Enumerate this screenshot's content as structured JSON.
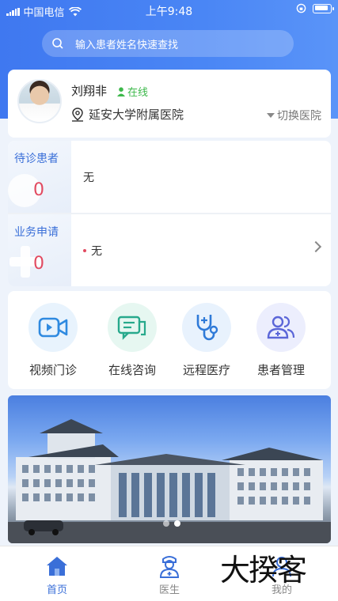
{
  "status_bar": {
    "carrier": "中国电信",
    "time": "上午9:48"
  },
  "search": {
    "placeholder": "输入患者姓名快速查找"
  },
  "doctor": {
    "name": "刘翔非",
    "status": "在线",
    "hospital": "延安大学附属医院",
    "switch_label": "切换医院"
  },
  "tasks": [
    {
      "title": "待诊患者",
      "count": "0",
      "value": "无"
    },
    {
      "title": "业务申请",
      "count": "0",
      "value": "无"
    }
  ],
  "quick_actions": [
    {
      "label": "视频门诊",
      "icon": "video-clinic-icon"
    },
    {
      "label": "在线咨询",
      "icon": "online-consult-icon"
    },
    {
      "label": "远程医疗",
      "icon": "stethoscope-icon"
    },
    {
      "label": "患者管理",
      "icon": "patients-icon"
    }
  ],
  "banner": {
    "slides": 2,
    "active_slide": 1
  },
  "tabbar": {
    "items": [
      {
        "label": "首页",
        "icon": "home-icon",
        "active": true
      },
      {
        "label": "医生",
        "icon": "doctor-icon",
        "active": false
      },
      {
        "label": "我的",
        "icon": "profile-icon",
        "active": false
      }
    ]
  },
  "watermark": "大揆客",
  "colors": {
    "primary": "#3a6fd8",
    "header": "#4a86f5",
    "online": "#3cb84a",
    "count": "#e24a60"
  }
}
